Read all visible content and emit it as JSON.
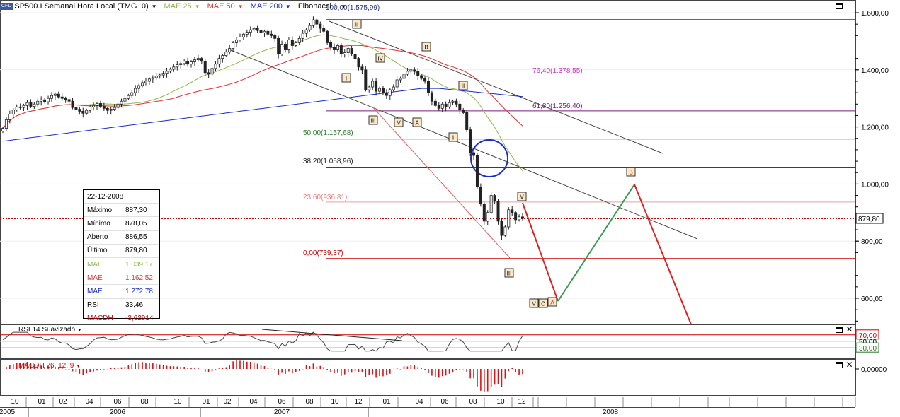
{
  "toolbar": {
    "symbol": "SP500.I Semanal Hora Local (TMG+0)",
    "mae25": "MAE 25",
    "mae50": "MAE 50",
    "mae200": "MAE 200",
    "fib": "Fibonacci 1"
  },
  "colors": {
    "mae25": "#8fb84a",
    "mae50": "#e03030",
    "mae200": "#1a2cc8",
    "fib100": "#203080",
    "fib764": "#cc33cc",
    "fib618": "#7a1a7a",
    "fib500": "#2a7a2a",
    "fib382": "#222222",
    "fib236": "#e8a0a0",
    "fib0": "#cc0000",
    "up_candle": "#2a2a2a",
    "down_candle": "#2a2a2a",
    "price_line": "#cc0000",
    "projection_down": "#e02020",
    "projection_up": "#3a9a50",
    "circle": "#1a2cc8"
  },
  "price_axis": {
    "ticks": [
      "1.600,00",
      "1.400,00",
      "1.200,00",
      "1.000,00",
      "800,00",
      "600,00"
    ],
    "current_label": "879,80"
  },
  "fib_labels": {
    "f100": "100,00(1.575,99)",
    "f764": "76,40(1.378,55)",
    "f618": "61,80(1.256,40)",
    "f500": "50,00(1.157,68)",
    "f382": "38,20(1.058,96)",
    "f236": "23,60(936,81)",
    "f0": "0,00(739,37)"
  },
  "wave_labels": [
    "II",
    "I",
    "IV",
    "B",
    "III",
    "V",
    "A",
    "II",
    "I",
    "V",
    "III",
    "V",
    "C",
    "A",
    "B"
  ],
  "infobox": {
    "date": "22-12-2008",
    "rows": [
      {
        "k": "Máximo",
        "v": "887,30"
      },
      {
        "k": "Mínimo",
        "v": "878,05"
      },
      {
        "k": "Aberto",
        "v": "886,55"
      },
      {
        "k": "Último",
        "v": "879,80"
      },
      {
        "k": "MAE",
        "v": "1.039,17"
      },
      {
        "k": "MAE",
        "v": "1.162,52"
      },
      {
        "k": "MAE",
        "v": "1.272,78"
      },
      {
        "k": "RSI",
        "v": "33,46"
      },
      {
        "k": "MACDH",
        "v": "-3,62914"
      }
    ]
  },
  "rsi": {
    "label": "RSI 14 Suavizado",
    "ticks": [
      "70,00",
      "50,00",
      "30,00"
    ]
  },
  "macd": {
    "label": "MACDH 26, 12, 9",
    "ticks": [
      "0,00000"
    ]
  },
  "time_axis": {
    "months": [
      "10",
      "01",
      "02",
      "04",
      "06",
      "08",
      "10",
      "01",
      "02",
      "04",
      "06",
      "08",
      "10",
      "12",
      "01",
      "04",
      "06",
      "08",
      "10",
      "12"
    ],
    "years": [
      "2005",
      "2006",
      "2007",
      "2008"
    ]
  },
  "chart_data": {
    "type": "candlestick",
    "title": "SP500.I Semanal Hora Local (TMG+0)",
    "ylim": [
      500,
      1650
    ],
    "y_ticks": [
      600,
      800,
      1000,
      1200,
      1400,
      1600
    ],
    "last_price": 879.8,
    "fibonacci": [
      {
        "level": 100.0,
        "price": 1575.99
      },
      {
        "level": 76.4,
        "price": 1378.55
      },
      {
        "level": 61.8,
        "price": 1256.4
      },
      {
        "level": 50.0,
        "price": 1157.68
      },
      {
        "level": 38.2,
        "price": 1058.96
      },
      {
        "level": 23.6,
        "price": 936.81
      },
      {
        "level": 0.0,
        "price": 739.37
      }
    ],
    "close_series": [
      1195,
      1225,
      1245,
      1260,
      1270,
      1268,
      1275,
      1285,
      1272,
      1280,
      1290,
      1295,
      1288,
      1300,
      1310,
      1315,
      1305,
      1300,
      1296,
      1290,
      1268,
      1262,
      1255,
      1248,
      1258,
      1270,
      1275,
      1282,
      1272,
      1265,
      1258,
      1262,
      1268,
      1280,
      1290,
      1300,
      1310,
      1320,
      1335,
      1345,
      1355,
      1360,
      1368,
      1372,
      1378,
      1382,
      1388,
      1395,
      1402,
      1410,
      1418,
      1422,
      1430,
      1420,
      1428,
      1435,
      1440,
      1430,
      1390,
      1385,
      1405,
      1420,
      1440,
      1450,
      1462,
      1475,
      1495,
      1505,
      1515,
      1525,
      1532,
      1540,
      1545,
      1538,
      1530,
      1535,
      1525,
      1520,
      1510,
      1455,
      1490,
      1470,
      1505,
      1485,
      1495,
      1510,
      1528,
      1540,
      1555,
      1575,
      1560,
      1545,
      1535,
      1495,
      1480,
      1470,
      1485,
      1455,
      1460,
      1475,
      1455,
      1440,
      1410,
      1400,
      1330,
      1340,
      1360,
      1325,
      1335,
      1320,
      1310,
      1330,
      1340,
      1365,
      1370,
      1385,
      1395,
      1400,
      1395,
      1380,
      1370,
      1360,
      1320,
      1290,
      1275,
      1265,
      1280,
      1270,
      1285,
      1290,
      1280,
      1260,
      1250,
      1190,
      1110,
      1100,
      990,
      930,
      870,
      900,
      960,
      940,
      870,
      820,
      850,
      910,
      900,
      875,
      885,
      879.8
    ]
  }
}
